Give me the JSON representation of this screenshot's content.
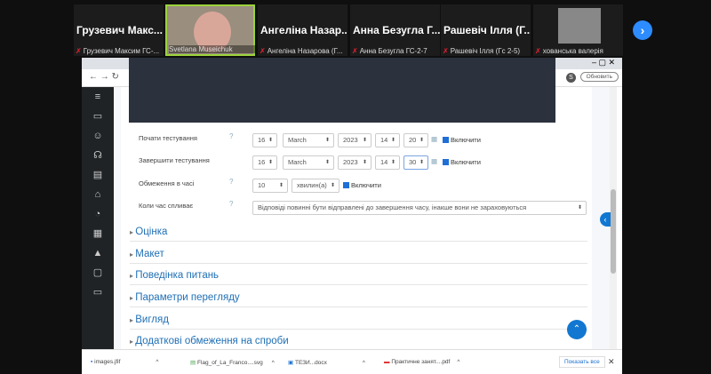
{
  "participants": [
    {
      "name": "Грузевич  Макс...",
      "label": "Грузевич Максим ГС-...",
      "muted": true
    },
    {
      "name": "",
      "label": "Svetlana Museichuk",
      "muted": false,
      "video": true
    },
    {
      "name": "Ангеліна  Назар...",
      "label": "Ангеліна Назарова (Г...",
      "muted": true
    },
    {
      "name": "Анна  Безугла  Г...",
      "label": "Анна Безугла ГС-2-7",
      "muted": true
    },
    {
      "name": "Рашевіч  Ілля  (Г...",
      "label": "Рашевіч Ілля (Гс 2-5)",
      "muted": true
    },
    {
      "name": "",
      "label": "хованська валерія",
      "muted": true
    }
  ],
  "browser": {
    "update_label": "Обновить",
    "profile": "S"
  },
  "form": {
    "start": {
      "label": "Почати тестування",
      "day": "16",
      "month": "March",
      "year": "2023",
      "hour": "14",
      "minute": "20",
      "enable": "Включити"
    },
    "end": {
      "label": "Завершити тестування",
      "day": "16",
      "month": "March",
      "year": "2023",
      "hour": "14",
      "minute": "30",
      "enable": "Включити"
    },
    "limit": {
      "label": "Обмеження в часі",
      "value": "10",
      "unit": "хвилин(а)",
      "enable": "Включити"
    },
    "expire": {
      "label": "Коли час спливає",
      "value": "Відповіді повинні бути відправлені до завершення часу, інакше вони не зараховуються"
    }
  },
  "sections": [
    "Оцінка",
    "Макет",
    "Поведінка питань",
    "Параметри перегляду",
    "Вигляд",
    "Додаткові обмеження на спроби"
  ],
  "downloads": {
    "items": [
      "images.jfif",
      "Flag_of_La_Franco....svg",
      "ТЕЗИ...docx",
      "Практичне занят....pdf"
    ],
    "show_all": "Показать все"
  }
}
